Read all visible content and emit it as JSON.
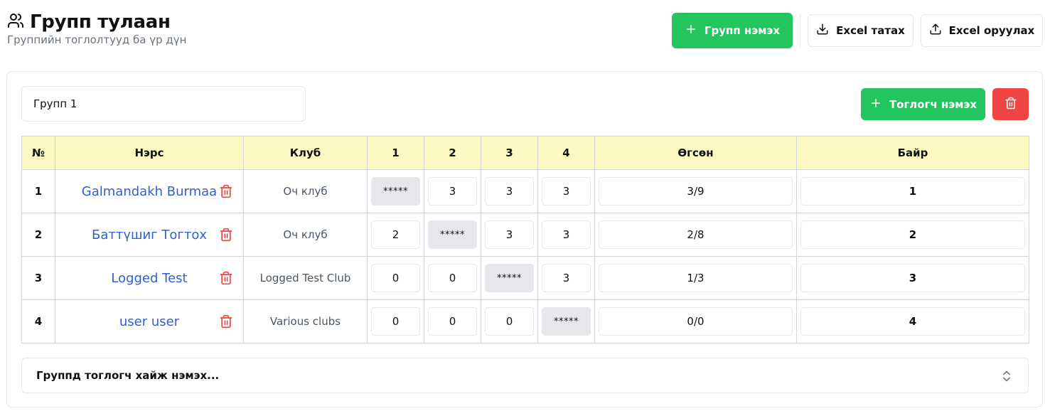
{
  "header": {
    "title": "Групп тулаан",
    "subtitle": "Группийн тоглолтууд ба үр дүн",
    "add_group_label": "Групп нэмэх",
    "excel_export_label": "Excel татах",
    "excel_import_label": "Excel оруулах"
  },
  "group": {
    "name_value": "Групп 1",
    "add_player_label": "Тоглогч нэмэх",
    "columns": {
      "no": "№",
      "name": "Нэрс",
      "club": "Клуб",
      "r1": "1",
      "r2": "2",
      "r3": "3",
      "r4": "4",
      "won": "Өгсөн",
      "place": "Байр"
    },
    "rows": [
      {
        "no": "1",
        "name": "Galmandakh Burmaa",
        "club": "Оч клуб",
        "s1": "*****",
        "s2": "3",
        "s3": "3",
        "s4": "3",
        "won": "3/9",
        "place": "1"
      },
      {
        "no": "2",
        "name": "Баттүшиг Тогтох",
        "club": "Оч клуб",
        "s1": "2",
        "s2": "*****",
        "s3": "3",
        "s4": "3",
        "won": "2/8",
        "place": "2"
      },
      {
        "no": "3",
        "name": "Logged Test",
        "club": "Logged Test Club",
        "s1": "0",
        "s2": "0",
        "s3": "*****",
        "s4": "3",
        "won": "1/3",
        "place": "3"
      },
      {
        "no": "4",
        "name": "user user",
        "club": "Various clubs",
        "s1": "0",
        "s2": "0",
        "s3": "0",
        "s4": "*****",
        "won": "0/0",
        "place": "4"
      }
    ],
    "search_placeholder": "Группд тоглогч хайж нэмэх..."
  },
  "colors": {
    "accent_green": "#22c55e",
    "danger_red": "#ef4444",
    "header_yellow": "#fef9c3",
    "link_blue": "#2f5fd0"
  },
  "icons": {
    "title": "users-icon",
    "add": "plus-icon",
    "export": "download-icon",
    "import": "upload-icon",
    "delete": "trash-icon",
    "select": "chevrons-up-down-icon"
  }
}
